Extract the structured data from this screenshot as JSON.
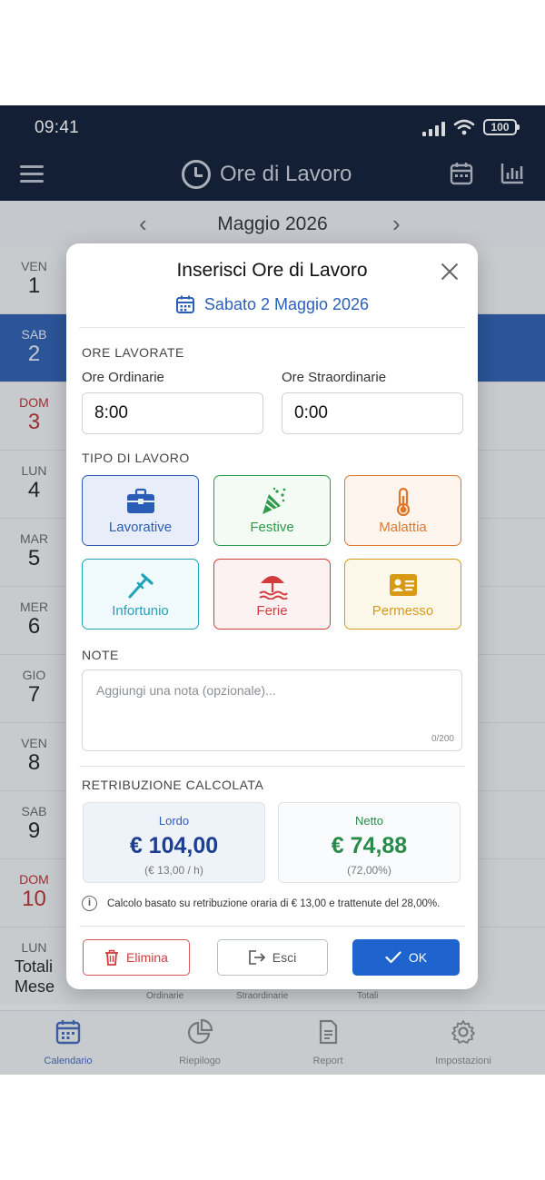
{
  "status": {
    "time": "09:41",
    "battery": "100"
  },
  "app": {
    "title": "Ore di Lavoro"
  },
  "month": {
    "label": "Maggio 2026",
    "prev": "‹",
    "next": "›"
  },
  "days": [
    {
      "name": "VEN",
      "num": "1"
    },
    {
      "name": "SAB",
      "num": "2"
    },
    {
      "name": "DOM",
      "num": "3"
    },
    {
      "name": "LUN",
      "num": "4"
    },
    {
      "name": "MAR",
      "num": "5"
    },
    {
      "name": "MER",
      "num": "6"
    },
    {
      "name": "GIO",
      "num": "7"
    },
    {
      "name": "VEN",
      "num": "8"
    },
    {
      "name": "SAB",
      "num": "9"
    },
    {
      "name": "DOM",
      "num": "10"
    },
    {
      "name": "LUN",
      "num": ""
    }
  ],
  "totals": {
    "title_line1": "Totali",
    "title_line2": "Mese",
    "ordinarie": "Ordinarie",
    "straordinarie": "Straordinarie",
    "totali": "Totali"
  },
  "nav": [
    {
      "label": "Calendario",
      "icon": "calendar-icon"
    },
    {
      "label": "Riepilogo",
      "icon": "pie-chart-icon"
    },
    {
      "label": "Report",
      "icon": "document-icon"
    },
    {
      "label": "Impostazioni",
      "icon": "gear-icon"
    }
  ],
  "modal": {
    "title": "Inserisci Ore di Lavoro",
    "date": "Sabato 2 Maggio 2026",
    "hours_section": "ORE LAVORATE",
    "ordinary_label": "Ore Ordinarie",
    "ordinary_value": "8:00",
    "overtime_label": "Ore Straordinarie",
    "overtime_value": "0:00",
    "type_section": "TIPO DI LAVORO",
    "types": [
      {
        "label": "Lavorative",
        "color": "#2a5db5",
        "bg": "#e8eef9",
        "icon": "briefcase-icon"
      },
      {
        "label": "Festive",
        "color": "#2f9a4a",
        "bg": "#f4fbf5",
        "icon": "party-popper-icon"
      },
      {
        "label": "Malattia",
        "color": "#e0782c",
        "bg": "#fdf5ee",
        "icon": "thermometer-icon"
      },
      {
        "label": "Infortunio",
        "color": "#1ea3b9",
        "bg": "#f1fafc",
        "icon": "crutch-icon"
      },
      {
        "label": "Ferie",
        "color": "#d23b3b",
        "bg": "#fdf2f2",
        "icon": "beach-umbrella-icon"
      },
      {
        "label": "Permesso",
        "color": "#d89a14",
        "bg": "#fdf8ea",
        "icon": "id-card-icon"
      }
    ],
    "note_section": "NOTE",
    "note_placeholder": "Aggiungi una nota (opzionale)...",
    "note_count": "0/200",
    "pay_section": "RETRIBUZIONE CALCOLATA",
    "gross": {
      "label": "Lordo",
      "value": "€ 104,00",
      "sub": "(€ 13,00 / h)",
      "color": "#1d3f8f"
    },
    "net": {
      "label": "Netto",
      "value": "€ 74,88",
      "sub": "(72,00%)",
      "color": "#2a8a48"
    },
    "info": "Calcolo basato su retribuzione oraria di € 13,00 e trattenute del 28,00%.",
    "buttons": {
      "delete": "Elimina",
      "exit": "Esci",
      "ok": "OK"
    }
  }
}
